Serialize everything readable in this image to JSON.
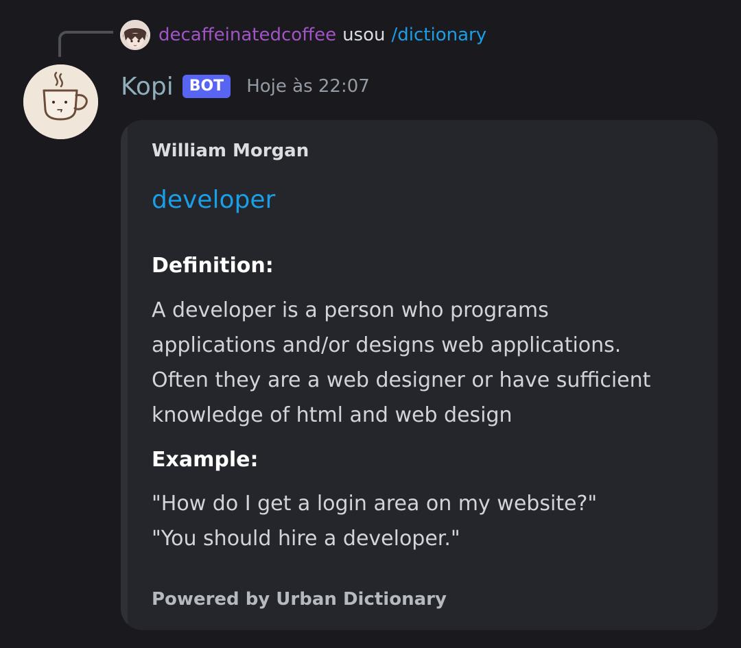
{
  "reply": {
    "username": "decaffeinatedcoffee",
    "verb": "usou",
    "command": "/dictionary"
  },
  "message": {
    "bot_name": "Kopi",
    "bot_tag": "BOT",
    "timestamp": "Hoje às 22:07"
  },
  "embed": {
    "author": "William Morgan",
    "title": "developer",
    "definition": {
      "label": "Definition:",
      "lines": [
        "A developer is a person who programs",
        "applications and/or designs web applications.",
        "Often they are a web designer or have sufficient",
        "knowledge of html and web design"
      ]
    },
    "example": {
      "label": "Example:",
      "lines": [
        "\"How do I get a login area on my website?\"",
        "\"You should hire a developer.\""
      ]
    },
    "footer": "Powered by Urban Dictionary"
  },
  "icons": {
    "reply_avatar": "anime-user-avatar",
    "bot_avatar": "coffee-cup-face-icon"
  },
  "colors": {
    "background": "#1a1a1e",
    "embed_background": "#24262c",
    "username": "#a154c5",
    "link": "#1a9fe6",
    "bot_tag": "#5865f2",
    "bot_name": "#8fb0bb"
  }
}
